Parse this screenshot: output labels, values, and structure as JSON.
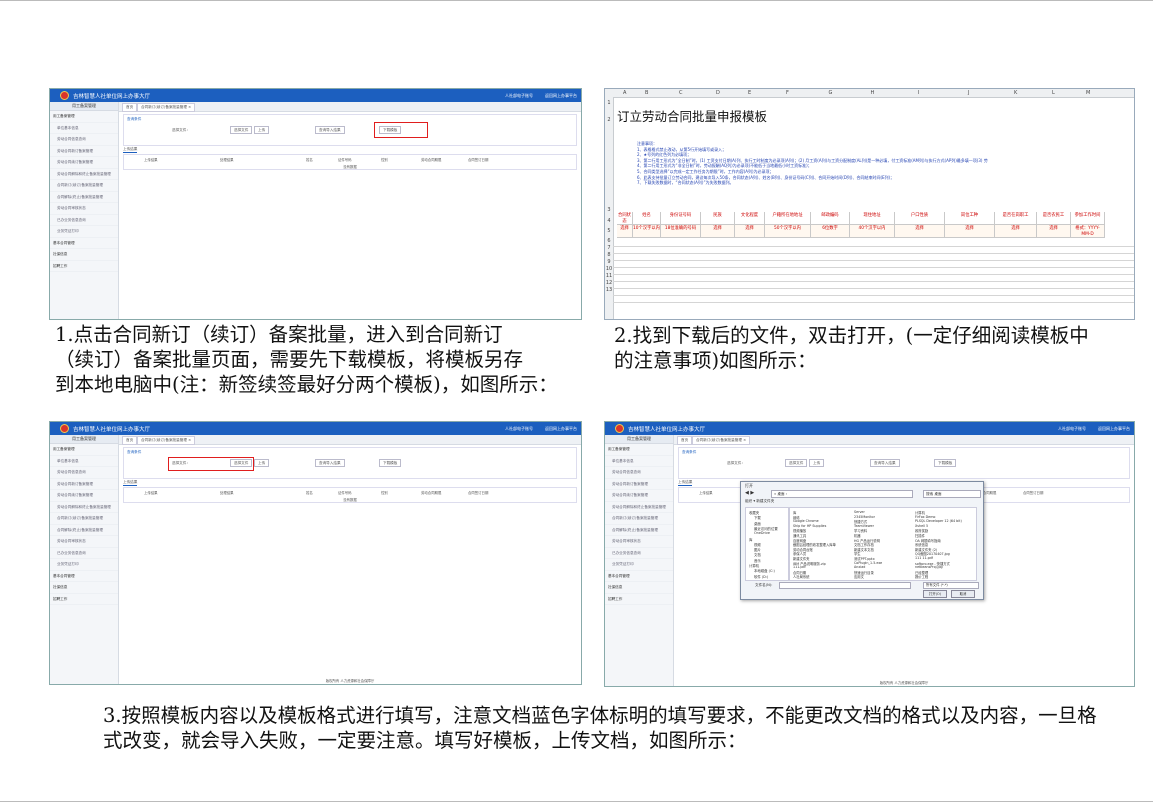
{
  "app": {
    "title": "吉林智慧人社单位网上办事大厅",
    "header_links": [
      "人社部电子账号",
      "返回网上办事平台"
    ],
    "sidebar_header": "用工备案管理",
    "sidebar_items": [
      "用工备案管理",
      "单位基本信息",
      "劳动合同信息查询",
      "劳动合同新订备案管理",
      "劳动合同续订备案管理",
      "劳动合同解除和终止备案批量管理",
      "合同新订(续订)备案批量管理",
      "合同解除(终止)备案批量管理",
      "劳动合同审核状态",
      "已办业务信息查询",
      "业务凭证打印"
    ],
    "sidebar_groups": [
      "基本合同管理",
      "社保信息",
      "招聘工作"
    ],
    "tab_home": "首页",
    "tab_active": "合同新订(续订)备案批量管理 ×",
    "panel_title": "查询条件",
    "file_label": "选择文件：",
    "btn_choose": "选择文件",
    "btn_upload": "上传",
    "btn_query": "查询导入结果",
    "btn_download": "下载模板",
    "grid_title": "上传结果",
    "grid_cols": [
      "上传结果",
      "处理结果",
      "姓名",
      "证件号码",
      "性别",
      "劳动合同期限",
      "合同签订日期"
    ],
    "grid_empty": "没有数据",
    "footer": "版权所有 人力资源和社会保障厅"
  },
  "sheet": {
    "col_letters": [
      "A",
      "B",
      "C",
      "D",
      "E",
      "F",
      "G",
      "H",
      "I",
      "J",
      "K",
      "L",
      "M"
    ],
    "title": "订立劳动合同批量申报模板",
    "notes": [
      "注意事项：",
      "1、表格格式禁止改动，从第5行开始填写或录入；",
      "2、★号列的红色列为必填项；",
      "3、第二行用工形式为“全日制”时，(1) 工资支付日期(A)列、执行工时制度为必录项(A列)；(2) 月工资(A列)与工资分配制度(AL列)是一种必填，付工资标准(AM列)与执行方式(AP列)最多填一项(3) 劳",
      "4、第二行用工形式为“非全日制”时，劳动报酬(AQ列)为必录项(不能低于当地最低小时工资标准)；",
      "5、合同类型选择“以完成一定工作任务为期限”时，工作内容(A列)为必录项；",
      "6、此表支持批量订立劳动合同，建议每次导入50条，合同状态(A列)、姓名(B列)、身份证号码(C列)、合同开始时间(D列)、合同结束时间(E列)；",
      "7、下载失败数据时，“合同状态(A列)”为失败数据列。"
    ],
    "header_row3": [
      "合同状态",
      "姓名",
      "身份证号码",
      "民族",
      "文化程度",
      "户籍所在地地址",
      "邮政编码",
      "现住地址",
      "户口性质",
      "岗位工种",
      "是否在岗职工",
      "是否农民工",
      "参加工作时间"
    ],
    "header_row4": [
      "选择",
      "10个汉字以内",
      "18位准确的号码",
      "选择",
      "选择",
      "50个汉字以内",
      "6位数字",
      "40个汉字以内",
      "选择",
      "选择",
      "选择",
      "选择",
      "格式：YYYY-MM-D"
    ],
    "row_numbers": [
      "1",
      "2",
      "3",
      "4",
      "5",
      "6",
      "7",
      "8",
      "9",
      "10",
      "11",
      "12",
      "13"
    ]
  },
  "dialog": {
    "title": "打开",
    "address": "« 桌面 ›",
    "search_placeholder": "搜索 桌面",
    "toolbar": "组织 ▾    新建文件夹",
    "tree": [
      "收藏夹",
      "下载",
      "桌面",
      "最近访问的位置",
      "OneDrive",
      "库",
      "视频",
      "图片",
      "文档",
      "音乐",
      "计算机",
      "本地磁盘 (C:)",
      "软件 (D:)"
    ],
    "files": [
      "库",
      "网络",
      "Google Chrome",
      "Ship for HP Supplies",
      "视频播放",
      "通讯工具",
      "百度网盘",
      "截图吕经理的收发整理入库单",
      "劳动合同台账",
      "参保人员",
      "新建文件夹",
      "IBM 产品说明服务.zip",
      "111.pdf",
      "合同日期",
      "人社局系统",
      "Server",
      "2345Monitor",
      "快捷方式",
      "TeamViewer",
      "学习资料",
      "机器",
      "HG 产品运行说明",
      "文档工作存档",
      "新建文本文档",
      "学生",
      "测试PPT.pptx",
      "CoPlugin_1.5.exe",
      "Anxiad",
      "快速运行目录",
      "应用文",
      "计算机",
      "FirFox Demo",
      "PLSQL Developer 12 (64 bit)",
      "Xshell 5",
      "政府奖励",
      "扫描件",
      "OA 网银填写指南",
      "系统信息",
      "新建文件夹 (2)",
      "QQ截图20170407.jpg",
      "111 11.pdf",
      "softpro.exe - 快捷方式",
      "netbeansProj.jpg",
      "已经整理",
      "报价工程"
    ],
    "filename_label": "文件名(N):",
    "filetype": "所有文件 (*.*)",
    "btn_open": "打开(O)",
    "btn_cancel": "取消"
  },
  "captions": {
    "step1": [
      "1.点击合同新订（续订）备案批量，进入到合同新订",
      "（续订）备案批量页面，需要先下载模板，将模板另存",
      "到本地电脑中(注：新签续签最好分两个模板)，如图所示："
    ],
    "step2": [
      "2.找到下载后的文件，双击打开，(一定仔细阅读模板中",
      "的注意事项)如图所示："
    ],
    "step3": [
      "3.按照模板内容以及模板格式进行填写，注意文档蓝色字体标明的填写要求，不能更改文档的格式以及内容，一旦格",
      "式改变，就会导入失败，一定要注意。填写好模板，上传文档，如图所示："
    ]
  }
}
